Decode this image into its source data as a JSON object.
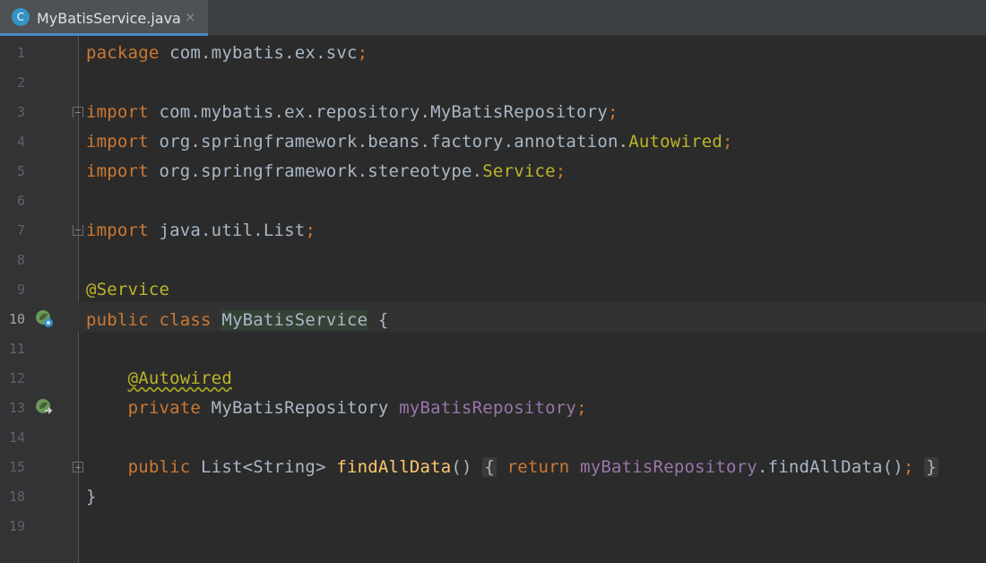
{
  "tab": {
    "icon_letter": "C",
    "file_name": "MyBatisService.java",
    "close_glyph": "×",
    "icon_color": "#3592c4"
  },
  "editor": {
    "line_numbers": [
      "1",
      "2",
      "3",
      "4",
      "5",
      "6",
      "7",
      "8",
      "9",
      "10",
      "11",
      "12",
      "13",
      "14",
      "15",
      "18",
      "19"
    ],
    "active_line": "10",
    "code": {
      "l1_kw": "package",
      "l1_rest": " com.mybatis.ex.svc",
      "l1_semi": ";",
      "l3_kw": "import",
      "l3_rest": " com.mybatis.ex.repository.MyBatisRepository",
      "l3_semi": ";",
      "l4_kw": "import",
      "l4_rest": " org.springframework.beans.factory.annotation.",
      "l4_cls": "Autowired",
      "l4_semi": ";",
      "l5_kw": "import",
      "l5_rest": " org.springframework.stereotype.",
      "l5_cls": "Service",
      "l5_semi": ";",
      "l7_kw": "import",
      "l7_rest": " java.util.List",
      "l7_semi": ";",
      "l9_ann": "@Service",
      "l10_kw": "public class",
      "l10_name": "MyBatisService",
      "l10_brace": " {",
      "l12_ann": "@Autowired",
      "l13_kw": "private",
      "l13_type": " MyBatisRepository ",
      "l13_field": "myBatisRepository",
      "l13_semi": ";",
      "l15_kw": "public",
      "l15_type": " List<String> ",
      "l15_method": "findAllData",
      "l15_parens": "()",
      "l15_open": "{",
      "l15_ret": "return",
      "l15_field": "myBatisRepository",
      "l15_call": ".findAllData()",
      "l15_semi": ";",
      "l15_close": "}",
      "l18_brace": "}"
    },
    "gutter_icons": [
      "spring-bean-class-icon",
      "spring-bean-injection-icon"
    ],
    "colors": {
      "background": "#2b2b2b",
      "keyword": "#cc7832",
      "annotation": "#bbb529",
      "field": "#9876aa",
      "method": "#ffc66d",
      "text": "#a9b7c6"
    }
  }
}
